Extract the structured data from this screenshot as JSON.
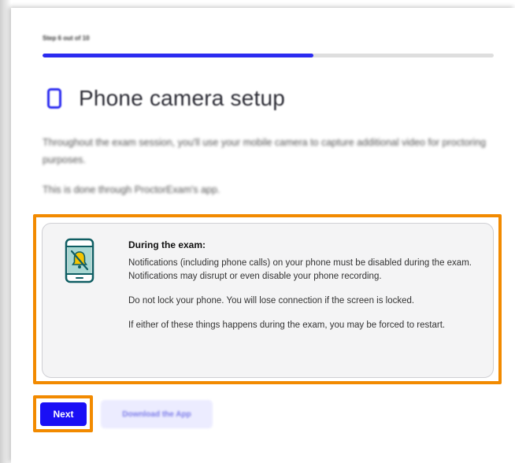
{
  "step": {
    "label": "Step 6 out of 10",
    "current": 6,
    "total": 10,
    "progress_fraction": 0.6
  },
  "page": {
    "title": "Phone camera setup",
    "title_icon": "phone-icon",
    "intro": "Throughout the exam session, you'll use your mobile camera to capture additional video for proctoring purposes.",
    "intro2": "This is done through ProctorExam's app."
  },
  "notice": {
    "icon": "phone-notifications-off-icon",
    "title": "During the exam:",
    "paragraphs": [
      "Notifications (including phone calls) on your phone must be disabled during the exam. Notifications may disrupt or even disable your phone recording.",
      "Do not lock your phone. You will lose connection if the screen is locked.",
      "If either of these things happens during the exam, you may be forced to restart."
    ]
  },
  "buttons": {
    "next_label": "Next",
    "download_label": "Download the App"
  },
  "colors": {
    "accent": "#1a0ff5",
    "highlight": "#f28a00",
    "icon_teal": "#0f5e63",
    "icon_yellow": "#f5c400"
  }
}
